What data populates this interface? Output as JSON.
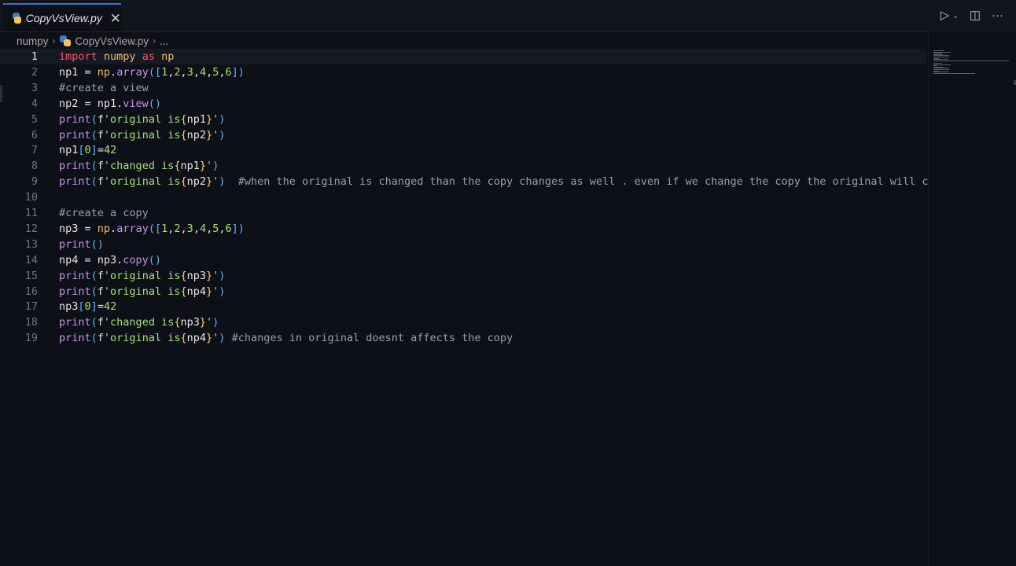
{
  "tab": {
    "title": "CopyVsView.py",
    "close": "✕"
  },
  "actions": {
    "run": "▷",
    "run_menu": "⌄",
    "split": "◫",
    "more": "···"
  },
  "breadcrumb": {
    "folder": "numpy",
    "file": "CopyVsView.py",
    "more": "...",
    "sep": "›"
  },
  "icons": {
    "file_icon": "python-icon",
    "accent": "#3b6fd4"
  },
  "lines": [
    {
      "n": "1",
      "tokens": [
        [
          "kw",
          "import"
        ],
        [
          "",
          " "
        ],
        [
          "mod",
          "numpy"
        ],
        [
          "",
          " "
        ],
        [
          "kw",
          "as"
        ],
        [
          "",
          " "
        ],
        [
          "mod",
          "np"
        ]
      ]
    },
    {
      "n": "2",
      "tokens": [
        [
          "",
          "np1 = "
        ],
        [
          "mod",
          "np"
        ],
        [
          "",
          "."
        ],
        [
          "fn",
          "array"
        ],
        [
          "br",
          "("
        ],
        [
          "br",
          "["
        ],
        [
          "num",
          "1"
        ],
        [
          "",
          ","
        ],
        [
          "num",
          "2"
        ],
        [
          "",
          ","
        ],
        [
          "num",
          "3"
        ],
        [
          "",
          ","
        ],
        [
          "num",
          "4"
        ],
        [
          "",
          ","
        ],
        [
          "num",
          "5"
        ],
        [
          "",
          ","
        ],
        [
          "num",
          "6"
        ],
        [
          "br",
          "]"
        ],
        [
          "br",
          ")"
        ]
      ]
    },
    {
      "n": "3",
      "tokens": [
        [
          "cmt",
          "#create a view"
        ]
      ]
    },
    {
      "n": "4",
      "tokens": [
        [
          "",
          "np2 = np1."
        ],
        [
          "fn",
          "view"
        ],
        [
          "br",
          "()"
        ]
      ]
    },
    {
      "n": "5",
      "tokens": [
        [
          "fn",
          "print"
        ],
        [
          "br",
          "("
        ],
        [
          "",
          "f"
        ],
        [
          "str",
          "'original is"
        ],
        [
          "brace",
          "{"
        ],
        [
          "",
          "np1"
        ],
        [
          "brace",
          "}"
        ],
        [
          "str",
          "'"
        ],
        [
          "br",
          ")"
        ]
      ]
    },
    {
      "n": "6",
      "tokens": [
        [
          "fn",
          "print"
        ],
        [
          "br",
          "("
        ],
        [
          "",
          "f"
        ],
        [
          "str",
          "'original is"
        ],
        [
          "brace",
          "{"
        ],
        [
          "",
          "np2"
        ],
        [
          "brace",
          "}"
        ],
        [
          "str",
          "'"
        ],
        [
          "br",
          ")"
        ]
      ]
    },
    {
      "n": "7",
      "tokens": [
        [
          "",
          "np1"
        ],
        [
          "br",
          "["
        ],
        [
          "num",
          "0"
        ],
        [
          "br",
          "]"
        ],
        [
          "",
          "="
        ],
        [
          "num",
          "42"
        ]
      ]
    },
    {
      "n": "8",
      "tokens": [
        [
          "fn",
          "print"
        ],
        [
          "br",
          "("
        ],
        [
          "",
          "f"
        ],
        [
          "str",
          "'changed is"
        ],
        [
          "brace",
          "{"
        ],
        [
          "",
          "np1"
        ],
        [
          "brace",
          "}"
        ],
        [
          "str",
          "'"
        ],
        [
          "br",
          ")"
        ]
      ]
    },
    {
      "n": "9",
      "tokens": [
        [
          "fn",
          "print"
        ],
        [
          "br",
          "("
        ],
        [
          "",
          "f"
        ],
        [
          "str",
          "'original is"
        ],
        [
          "brace",
          "{"
        ],
        [
          "",
          "np2"
        ],
        [
          "brace",
          "}"
        ],
        [
          "str",
          "'"
        ],
        [
          "br",
          ")"
        ],
        [
          "",
          "  "
        ],
        [
          "cmt",
          "#when the original is changed than the copy changes as well . even if we change the copy the original will ch"
        ]
      ]
    },
    {
      "n": "10",
      "tokens": []
    },
    {
      "n": "11",
      "tokens": [
        [
          "cmt",
          "#create a copy"
        ]
      ]
    },
    {
      "n": "12",
      "tokens": [
        [
          "",
          "np3 = "
        ],
        [
          "mod",
          "np"
        ],
        [
          "",
          "."
        ],
        [
          "fn",
          "array"
        ],
        [
          "br",
          "("
        ],
        [
          "br",
          "["
        ],
        [
          "num",
          "1"
        ],
        [
          "",
          ","
        ],
        [
          "num",
          "2"
        ],
        [
          "",
          ","
        ],
        [
          "num",
          "3"
        ],
        [
          "",
          ","
        ],
        [
          "num",
          "4"
        ],
        [
          "",
          ","
        ],
        [
          "num",
          "5"
        ],
        [
          "",
          ","
        ],
        [
          "num",
          "6"
        ],
        [
          "br",
          "]"
        ],
        [
          "br",
          ")"
        ]
      ]
    },
    {
      "n": "13",
      "tokens": [
        [
          "fn",
          "print"
        ],
        [
          "br",
          "()"
        ]
      ]
    },
    {
      "n": "14",
      "tokens": [
        [
          "",
          "np4 = np3."
        ],
        [
          "fn",
          "copy"
        ],
        [
          "br",
          "()"
        ]
      ]
    },
    {
      "n": "15",
      "tokens": [
        [
          "fn",
          "print"
        ],
        [
          "br",
          "("
        ],
        [
          "",
          "f"
        ],
        [
          "str",
          "'original is"
        ],
        [
          "brace",
          "{"
        ],
        [
          "",
          "np3"
        ],
        [
          "brace",
          "}"
        ],
        [
          "str",
          "'"
        ],
        [
          "br",
          ")"
        ]
      ]
    },
    {
      "n": "16",
      "tokens": [
        [
          "fn",
          "print"
        ],
        [
          "br",
          "("
        ],
        [
          "",
          "f"
        ],
        [
          "str",
          "'original is"
        ],
        [
          "brace",
          "{"
        ],
        [
          "",
          "np4"
        ],
        [
          "brace",
          "}"
        ],
        [
          "str",
          "'"
        ],
        [
          "br",
          ")"
        ]
      ]
    },
    {
      "n": "17",
      "tokens": [
        [
          "",
          "np3"
        ],
        [
          "br",
          "["
        ],
        [
          "num",
          "0"
        ],
        [
          "br",
          "]"
        ],
        [
          "",
          "="
        ],
        [
          "num",
          "42"
        ]
      ]
    },
    {
      "n": "18",
      "tokens": [
        [
          "fn",
          "print"
        ],
        [
          "br",
          "("
        ],
        [
          "",
          "f"
        ],
        [
          "str",
          "'changed is"
        ],
        [
          "brace",
          "{"
        ],
        [
          "",
          "np3"
        ],
        [
          "brace",
          "}"
        ],
        [
          "str",
          "'"
        ],
        [
          "br",
          ")"
        ]
      ]
    },
    {
      "n": "19",
      "tokens": [
        [
          "fn",
          "print"
        ],
        [
          "br",
          "("
        ],
        [
          "",
          "f"
        ],
        [
          "str",
          "'original is"
        ],
        [
          "brace",
          "{"
        ],
        [
          "",
          "np4"
        ],
        [
          "brace",
          "}"
        ],
        [
          "str",
          "'"
        ],
        [
          "br",
          ")"
        ],
        [
          "",
          " "
        ],
        [
          "cmt",
          "#changes in original doesnt affects the copy"
        ]
      ]
    }
  ],
  "active_line": "1"
}
